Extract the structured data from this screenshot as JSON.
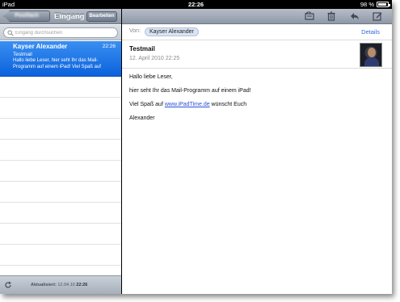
{
  "status_bar": {
    "carrier": "iPad",
    "time": "22:26",
    "battery": "98 %"
  },
  "left_pane": {
    "back_button": "Postfach",
    "title": "Eingang",
    "edit_button": "Bearbeiten",
    "search": {
      "placeholder": "Eingang durchsuchen",
      "value": ""
    },
    "messages": [
      {
        "sender": "Kayser Alexander",
        "time": "22:26",
        "subject": "Testmail",
        "preview": "Hallo liebe Leser, hier seht Ihr das Mail-Programm auf einem iPad! Viel Spaß auf",
        "selected": true
      }
    ],
    "footer": {
      "updated_label": "Aktualisiert:",
      "updated_date": "12.04.10",
      "updated_time": "22:26"
    }
  },
  "right_pane": {
    "toolbar_icons": [
      "folder-icon",
      "trash-icon",
      "reply-icon",
      "compose-icon"
    ],
    "from_label": "Von:",
    "from_name": "Kayser Alexander",
    "details_link": "Details",
    "subject": "Testmail",
    "date": "12. April 2010 22:25",
    "body": {
      "greeting": "Hallo liebe Leser,",
      "line1": "hier seht Ihr das Mail-Programm auf einem iPad!",
      "line2_before": "Viel Spaß auf ",
      "line2_link": "www.iPadTime.de",
      "line2_after": " wünscht Euch",
      "signature": "Alexander"
    }
  },
  "colors": {
    "accent": "#0b62dc",
    "link": "#2f6cdd",
    "toolbar": "#a3acb8"
  }
}
